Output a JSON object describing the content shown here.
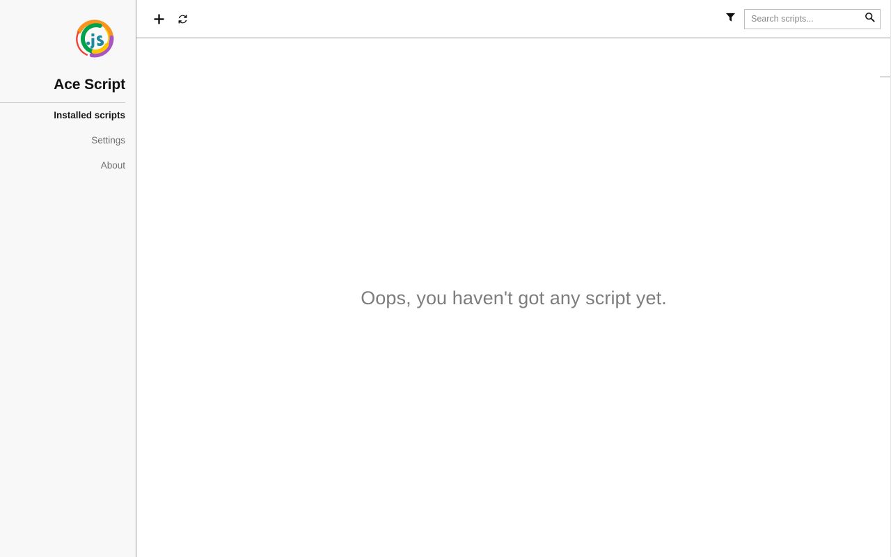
{
  "app": {
    "name": "Ace Script",
    "logo_icon": "acescript-js-logo-icon",
    "colors": {
      "accent_teal": "#1c8a9c",
      "arc_orange": "#f7941e",
      "arc_green": "#00a14b",
      "arc_purple": "#a855c4",
      "arc_yellow": "#fdc500",
      "arc_red": "#ef4136",
      "sidebar_bg": "#f8f8f8",
      "divider": "#9a9a9a",
      "muted_text": "#6e6e6e",
      "empty_text": "#7d7d7d"
    }
  },
  "sidebar": {
    "title": "Ace Script",
    "items": [
      {
        "label": "Installed scripts",
        "name": "installed-scripts",
        "active": true
      },
      {
        "label": "Settings",
        "name": "settings",
        "active": false
      },
      {
        "label": "About",
        "name": "about",
        "active": false
      }
    ]
  },
  "toolbar": {
    "add_label": "+",
    "add_icon": "plus-icon",
    "refresh_icon": "refresh-icon",
    "filter_icon": "filter-icon",
    "search_icon": "search-icon"
  },
  "search": {
    "placeholder": "Search scripts...",
    "value": ""
  },
  "main": {
    "empty_message": "Oops, you haven't got any script yet."
  }
}
